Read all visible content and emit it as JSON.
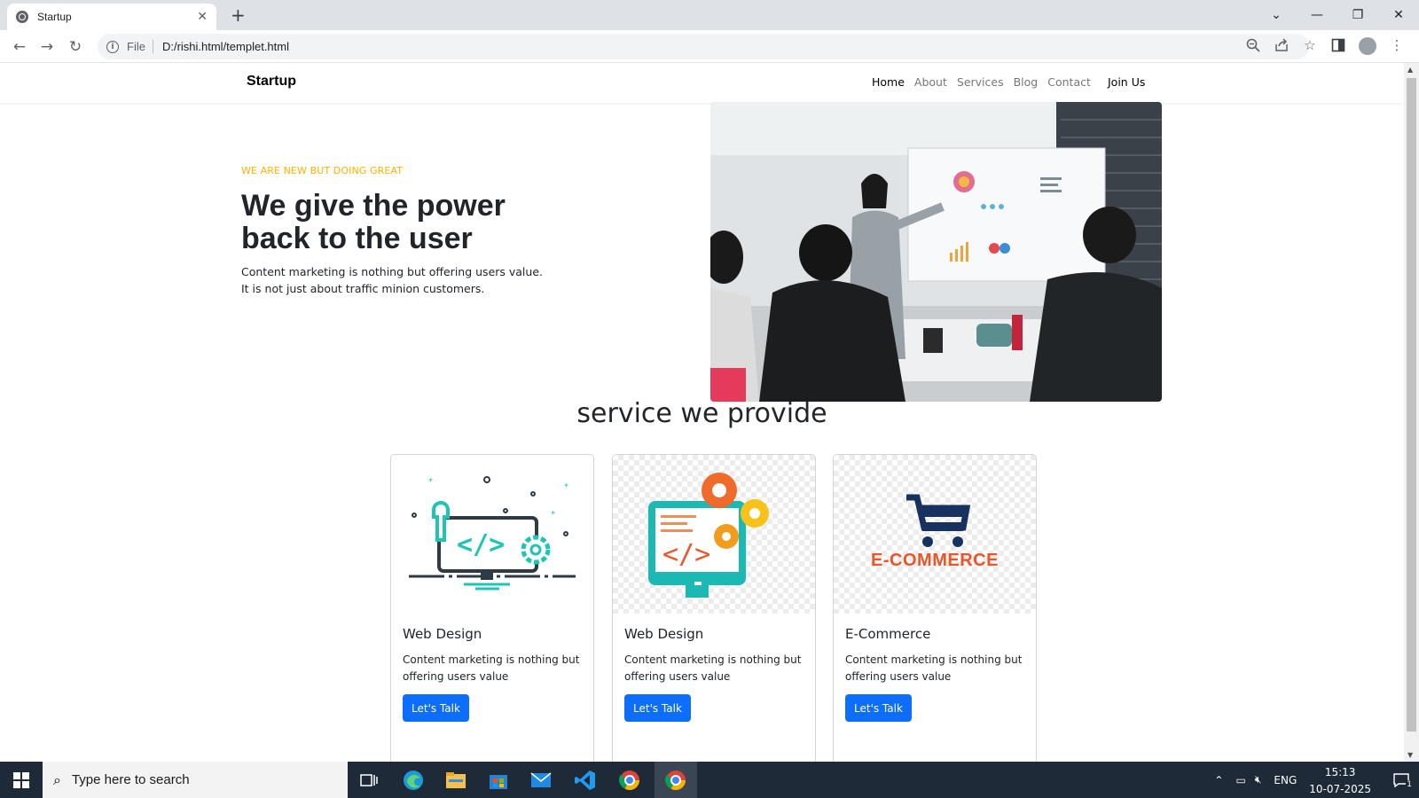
{
  "browser": {
    "tab_title": "Startup",
    "tab_close": "✕",
    "new_tab": "+",
    "scheme_label": "File",
    "url": "D:/rishi.html/templet.html",
    "info_glyph": "i"
  },
  "site": {
    "brand": "Startup",
    "nav": [
      "Home",
      "About",
      "Services",
      "Blog",
      "Contact"
    ],
    "join": "Join Us",
    "hero": {
      "eyebrow": "WE ARE NEW BUT DOING GREAT",
      "title": "We give the power back to the user",
      "text_line1": "Content marketing is nothing but offering users value.",
      "text_line2": "It is not just about traffic minion customers."
    },
    "section_title": "service we provide",
    "cards": [
      {
        "title": "Web Design",
        "text": "Content marketing is nothing but offering users value",
        "button": "Let's Talk",
        "icon": "web-design-monitor-icon"
      },
      {
        "title": "Web Design",
        "text": "Content marketing is nothing but offering users value",
        "button": "Let's Talk",
        "icon": "monitor-gears-icon"
      },
      {
        "title": "E-Commerce",
        "text": "Content marketing is nothing but offering users value",
        "button": "Let's Talk",
        "icon": "shopping-cart-icon",
        "logo_text": "E-COMMERCE"
      }
    ]
  },
  "taskbar": {
    "search_placeholder": "Type here to search",
    "language": "ENG",
    "time": "15:13",
    "date": "10-07-2025",
    "notification_count": "1"
  },
  "colors": {
    "accent": "#0d6efd",
    "eyebrow": "#ffb100",
    "ecommerce_orange": "#e8562a",
    "ecommerce_navy": "#17325e",
    "teal": "#1bb8b4"
  }
}
